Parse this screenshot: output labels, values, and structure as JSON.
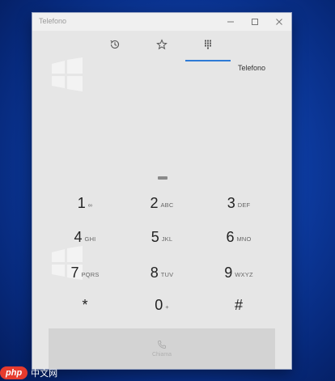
{
  "window": {
    "title": "Telefono"
  },
  "tabs": [
    {
      "icon": "history-icon"
    },
    {
      "icon": "star-icon"
    },
    {
      "icon": "dialpad-icon"
    }
  ],
  "active_tab": 2,
  "caller_label": "Telefono",
  "keypad": [
    {
      "digit": "1",
      "letters": "∞"
    },
    {
      "digit": "2",
      "letters": "ABC"
    },
    {
      "digit": "3",
      "letters": "DEF"
    },
    {
      "digit": "4",
      "letters": "GHI"
    },
    {
      "digit": "5",
      "letters": "JKL"
    },
    {
      "digit": "6",
      "letters": "MNO"
    },
    {
      "digit": "7",
      "letters": "PQRS"
    },
    {
      "digit": "8",
      "letters": "TUV"
    },
    {
      "digit": "9",
      "letters": "WXYZ"
    },
    {
      "digit": "*",
      "letters": ""
    },
    {
      "digit": "0",
      "letters": "+"
    },
    {
      "digit": "#",
      "letters": ""
    }
  ],
  "call_button": {
    "label": "Chiama",
    "icon": "phone-icon"
  },
  "watermark": {
    "badge": "php",
    "text": "中文网"
  },
  "colors": {
    "accent": "#2e7bd6",
    "window_bg": "#e6e6e6",
    "call_bg": "#d3d3d3"
  }
}
